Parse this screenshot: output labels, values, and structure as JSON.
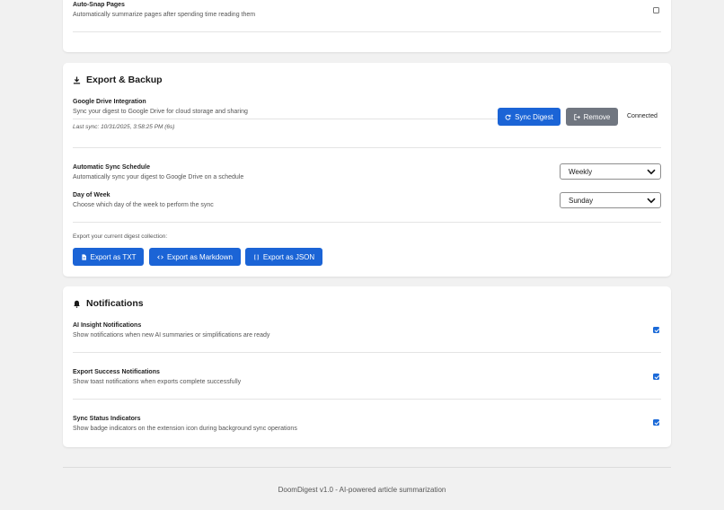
{
  "auto_snap": {
    "label": "Auto-Snap Pages",
    "description": "Automatically summarize pages after spending time reading them",
    "checked": false
  },
  "export_backup": {
    "title": "Export & Backup",
    "icon": "download-icon",
    "drive": {
      "label": "Google Drive Integration",
      "description": "Sync your digest to Google Drive for cloud storage and sharing",
      "last_sync": "Last sync: 10/31/2025, 3:58:25 PM (6s)",
      "sync_button": "Sync Digest",
      "remove_button": "Remove",
      "status": "Connected"
    },
    "schedule": {
      "label": "Automatic Sync Schedule",
      "description": "Automatically sync your digest to Google Drive on a schedule",
      "value": "Weekly"
    },
    "day": {
      "label": "Day of Week",
      "description": "Choose which day of the week to perform the sync",
      "value": "Sunday"
    },
    "export_prompt": "Export your current digest collection:",
    "export_txt": "Export as TXT",
    "export_md": "Export as Markdown",
    "export_json": "Export as JSON"
  },
  "notifications": {
    "title": "Notifications",
    "icon": "bell-icon",
    "items": [
      {
        "label": "AI Insight Notifications",
        "description": "Show notifications when new AI summaries or simplifications are ready",
        "checked": true
      },
      {
        "label": "Export Success Notifications",
        "description": "Show toast notifications when exports complete successfully",
        "checked": true
      },
      {
        "label": "Sync Status Indicators",
        "description": "Show badge indicators on the extension icon during background sync operations",
        "checked": true
      }
    ]
  },
  "footer": "DoomDigest v1.0 - AI-powered article summarization",
  "colors": {
    "accent": "#1b64d6",
    "secondary": "#707680",
    "background": "#f1f1f1"
  }
}
